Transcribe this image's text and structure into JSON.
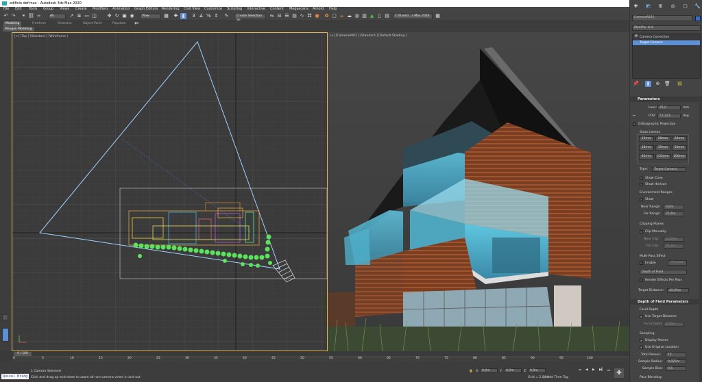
{
  "title": "edificio def.max - Autodesk 3ds Max 2020",
  "menu": [
    "File",
    "Edit",
    "Tools",
    "Group",
    "Views",
    "Create",
    "Modifiers",
    "Animation",
    "Graph Editors",
    "Rendering",
    "Civil View",
    "Customize",
    "Scripting",
    "Interactive",
    "Content",
    "Megascans",
    "Arnold",
    "Help"
  ],
  "toolbar": {
    "filter": "All",
    "refcoord": "View",
    "selset": "Create Selection Se",
    "path": "C:\\Users\\...s Max 2020"
  },
  "ribbon": {
    "tabs": [
      "Modeling",
      "Freeform",
      "Selection",
      "Object Paint",
      "Populate"
    ],
    "sub": "Polygon Modeling"
  },
  "viewports": {
    "left_label": "[+] [Top ] [Standard ] [Wireframe ]",
    "right_label": "[+] [CameraA001 ] [Standard ] [Default Shading ]"
  },
  "panel": {
    "object_name": "CameraA001",
    "modifier_list": "Modifier List",
    "stack": [
      "Camera Correction",
      "Target Camera"
    ],
    "parameters": "Parameters",
    "lens_label": "Lens:",
    "lens_value": "35,0",
    "lens_unit": "mm",
    "fov_label": "FOV:",
    "fov_value": "57,221",
    "fov_unit": "deg.",
    "ortho": "Orthographic Projection",
    "stock_lenses": "Stock Lenses",
    "lenses": [
      "15mm",
      "20mm",
      "24mm",
      "28mm",
      "35mm",
      "50mm",
      "85mm",
      "135mm",
      "200mm"
    ],
    "type_label": "Type:",
    "type_value": "Target Camera",
    "show_cone": "Show Cone",
    "show_horizon": "Show Horizon",
    "env_ranges": "Environment Ranges",
    "env_show": "Show",
    "near_range_label": "Near Range:",
    "near_range": "0,0m",
    "far_range_label": "Far Range:",
    "far_range": "25,4m",
    "clip_planes": "Clipping Planes",
    "clip_manual": "Clip Manually",
    "near_clip_label": "Near Clip:",
    "near_clip": "0,025m",
    "far_clip_label": "Far Clip:",
    "far_clip": "25,4m",
    "multipass": "Multi-Pass Effect",
    "enable": "Enable",
    "preview": "Preview",
    "dof_select": "Depth of Field",
    "render_effects": "Render Effects Per Pass",
    "target_dist_label": "Target Distance:",
    "target_dist": "42,65m",
    "dof_params": "Depth of Field Parameters",
    "focal_depth": "Focal Depth",
    "use_target": "Use Target Distance",
    "focal_depth_label": "Focal Depth:",
    "focal_depth_val": "2,54m",
    "sampling": "Sampling",
    "display_passes": "Display Passes",
    "use_orig": "Use Original Location",
    "total_passes_label": "Total Passes:",
    "total_passes": "12",
    "sample_radius_label": "Sample Radius:",
    "sample_radius": "0,025m",
    "sample_bias_label": "Sample Bias:",
    "sample_bias": "0,5",
    "pass_blending": "Pass Blending"
  },
  "timeline": {
    "frame": "0 / 100",
    "ticks": [
      "0",
      "5",
      "10",
      "15",
      "20",
      "25",
      "30",
      "35",
      "40",
      "45",
      "50",
      "55",
      "60",
      "65",
      "70",
      "75",
      "80",
      "85",
      "90",
      "95",
      "100"
    ]
  },
  "status": {
    "script": "Quixel Bridg",
    "selected": "1 Camera Selected",
    "prompt": "Click and drag up-and-down to zoom all non-camera views in and out",
    "grid": "Grid = 2,54m",
    "addtag": "Add Time Tag",
    "x_label": "X:",
    "y_label": "Y:",
    "z_label": "Z:",
    "x": "0,0m",
    "y": "0,0m",
    "z": "0,0m"
  }
}
